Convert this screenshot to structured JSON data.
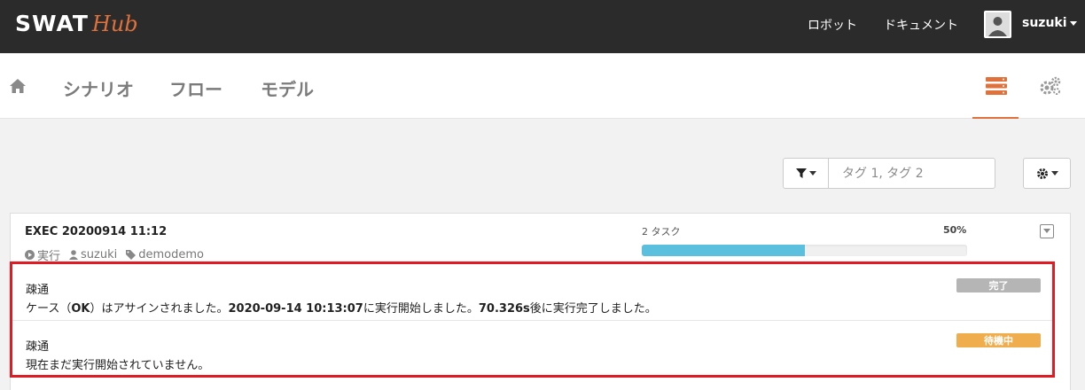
{
  "header": {
    "logo_main": "SWAT",
    "logo_sub": "Hub",
    "links": [
      "ロボット",
      "ドキュメント"
    ],
    "user": "suzuki"
  },
  "nav": {
    "items": [
      "シナリオ",
      "フロー",
      "モデル"
    ]
  },
  "filter": {
    "placeholder": "タグ 1, タグ 2"
  },
  "execution": {
    "title": "EXEC 20200914 11:12",
    "status": "実行",
    "user": "suzuki",
    "tag": "demodemo",
    "task_count": "2 タスク",
    "progress_percent": "50%",
    "progress_value": 0.5
  },
  "tasks": [
    {
      "name": "疎通",
      "desc_parts": [
        "ケース（",
        "OK",
        "）はアサインされました。",
        "2020-09-14 10:13:07",
        "に実行開始しました。",
        "70.326s",
        "後に実行完了しました。"
      ],
      "badge": "完了"
    },
    {
      "name": "疎通",
      "desc": "現在まだ実行開始されていません。",
      "badge": "待機中"
    }
  ],
  "colors": {
    "accent": "#e0713a",
    "progress": "#5bc0de",
    "highlight_border": "#e01b24",
    "badge_done": "#b5b5b5",
    "badge_wait": "#f0ad4e"
  }
}
